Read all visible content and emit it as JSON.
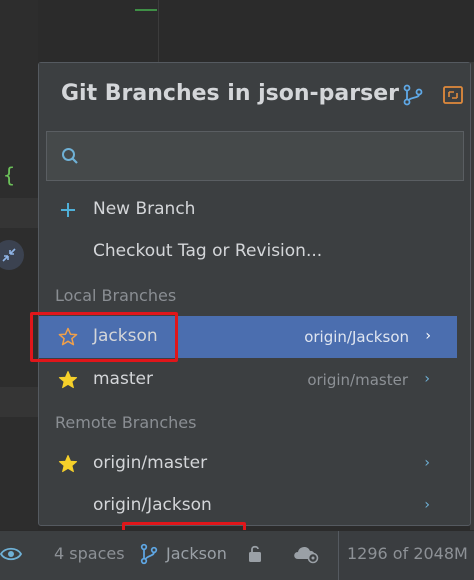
{
  "popup": {
    "title": "Git Branches in json-parser",
    "header_icons": [
      "branch-graph-icon",
      "expand-icon"
    ],
    "search": {
      "value": "",
      "placeholder": ""
    },
    "actions": [
      {
        "label": "New Branch",
        "icon": "plus-icon"
      },
      {
        "label": "Checkout Tag or Revision...",
        "icon": ""
      }
    ],
    "local_section": "Local Branches",
    "local_branches": [
      {
        "name": "Jackson",
        "tracking": "origin/Jackson",
        "icon": "star-outline-icon",
        "selected": true
      },
      {
        "name": "master",
        "tracking": "origin/master",
        "icon": "star-filled-icon",
        "selected": false
      }
    ],
    "remote_section": "Remote Branches",
    "remote_branches": [
      {
        "name": "origin/master",
        "icon": "star-filled-icon"
      },
      {
        "name": "origin/Jackson",
        "icon": ""
      }
    ]
  },
  "statusbar": {
    "indent": "4 spaces",
    "branch": "Jackson",
    "memory": "1296 of 2048M"
  },
  "colors": {
    "selection": "#4b6eaf",
    "highlight_box": "#e0161a",
    "accent": "#6fb1d6",
    "star": "#f5d02a"
  }
}
